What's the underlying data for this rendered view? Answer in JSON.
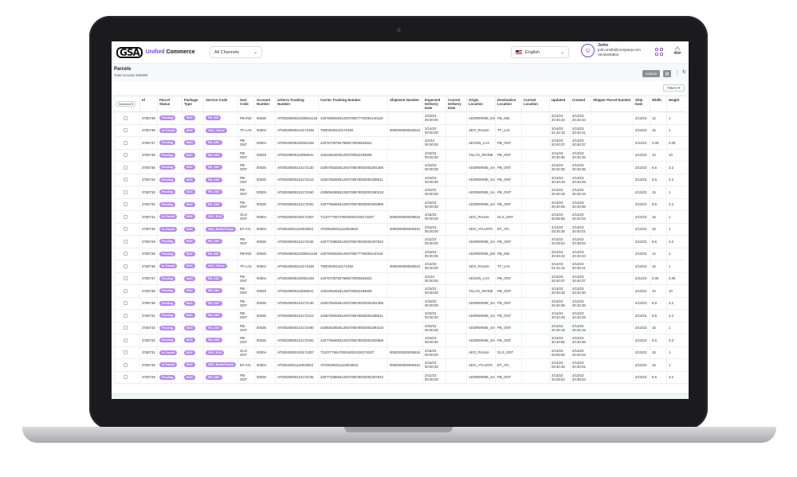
{
  "header": {
    "logo_mark": "GSA",
    "logo_accent": "Unified",
    "logo_text": "Commerce",
    "channel_select": "All Channels",
    "language_select": "English",
    "user_name": "John",
    "user_email": "john.smith@company.com",
    "user_role": "VendorEditor"
  },
  "page": {
    "title": "Parcels",
    "total_records": "Total records 340698",
    "actions_label": "Actions",
    "filters_label": "Filters",
    "selected_label": "Selected"
  },
  "columns": [
    "Id",
    "Parcel Status",
    "Package Type",
    "Service Code",
    "Sort Code",
    "Account Number",
    "airterra Tracking Number",
    "Carrier Tracking Number",
    "Shipment Number",
    "Expected Delivery Date",
    "Current Delivery Date",
    "Origin Location",
    "Destination Location",
    "Current Location",
    "Updated",
    "Created",
    "Shipper Parcel Number",
    "Ship Date",
    "Width",
    "Height"
  ],
  "rows": [
    {
      "id": "3750739",
      "status": "Pending",
      "type": "BOX",
      "service": "PB_IND",
      "sort": "PB-IND",
      "account": "00025",
      "airterra": "AT0002500021000621125",
      "carrier": "420760829261292700577702002140119",
      "shipment": "",
      "expected": "2/23/23 00:00:00",
      "current": "",
      "origin": "ADORERME_EWR",
      "dest": "PB_IND",
      "curloc": "",
      "updated": "2/13/23 20:40:43",
      "created": "2/13/23 20:40:43",
      "shipper": "",
      "shipdate": "2/13/23",
      "width": "12",
      "height": "1"
    },
    {
      "id": "3750738",
      "status": "In-Transit",
      "type": "BOX",
      "service": "GXC_Tforce",
      "sort": "TF-LAX",
      "account": "00004",
      "airterra": "AT00040000210174428",
      "carrier": "T0004000210174428",
      "shipment": "0000000000035524",
      "expected": "2/14/23 00:00:00",
      "current": "",
      "origin": "AEO_PALMA",
      "dest": "TF_LAX",
      "curloc": "",
      "updated": "2/14/23 01:42:15",
      "created": "2/13/23 20:40:41",
      "shipper": "",
      "shipdate": "2/13/23",
      "width": "15",
      "height": "1"
    },
    {
      "id": "3750737",
      "status": "Pending",
      "type": "BAG",
      "service": "PB_ONT",
      "sort": "PB-ONT",
      "account": "00004",
      "airterra": "AT00040006100002429",
      "carrier": "420757057927989270000554531",
      "shipment": "",
      "expected": "3/1/23 00:00:00",
      "current": "",
      "origin": "AEGON_LAX",
      "dest": "PB_ONT",
      "curloc": "",
      "updated": "2/13/23 20:40:37",
      "created": "2/13/23 20:40:37",
      "shipper": "",
      "shipdate": "2/21/23",
      "width": "0.05",
      "height": "0.05"
    },
    {
      "id": "3750736",
      "status": "Pending",
      "type": "BOX",
      "service": "PB_ONT",
      "sort": "PB-ONT",
      "account": "00029",
      "airterra": "AT00029000110094841",
      "carrier": "420225549261292700022293609",
      "shipment": "",
      "expected": "2/23/23 00:00:00",
      "current": "",
      "origin": "TILLYS_IRVINE",
      "dest": "PB_ONT",
      "curloc": "",
      "updated": "2/13/23 20:40:36",
      "created": "2/13/23 20:40:36",
      "shipper": "",
      "shipdate": "2/13/23",
      "width": "10",
      "height": "10"
    },
    {
      "id": "3750735",
      "status": "Pending",
      "type": "BOX",
      "service": "PB_ONT",
      "sort": "PB-ONT",
      "account": "00025",
      "airterra": "AT00025000110172130",
      "carrier": "420670529261292700578002002291308",
      "shipment": "",
      "expected": "2/23/23 00:00:00",
      "current": "",
      "origin": "ADORERME_SAN",
      "dest": "PB_ONT",
      "curloc": "",
      "updated": "2/13/23 20:40:35",
      "created": "2/13/23 20:40:35",
      "shipper": "",
      "shipdate": "2/13/23",
      "width": "8.5",
      "height": "3.2"
    },
    {
      "id": "3750734",
      "status": "Pending",
      "type": "BOX",
      "service": "PB_ONT",
      "sort": "PB-ONT",
      "account": "00025",
      "airterra": "AT00025000110172313",
      "carrier": "420670509261292700578002002298611",
      "shipment": "",
      "expected": "2/23/23 00:00:00",
      "current": "",
      "origin": "ADORERME_SAN",
      "dest": "PB_ONT",
      "curloc": "",
      "updated": "2/13/23 20:40:29",
      "created": "2/13/23 20:40:29",
      "shipper": "",
      "shipdate": "2/13/23",
      "width": "8.5",
      "height": "3.2"
    },
    {
      "id": "3750733",
      "status": "Pending",
      "type": "BOX",
      "service": "PB_ONT",
      "sort": "PB-ONT",
      "account": "00025",
      "airterra": "AT00025000110172490",
      "carrier": "420806289261292700578002002290219",
      "shipment": "",
      "expected": "2/23/23 00:00:00",
      "current": "",
      "origin": "ADORERME_SAN",
      "dest": "PB_ONT",
      "curloc": "",
      "updated": "2/13/23 20:40:19",
      "created": "2/13/23 20:40:19",
      "shipper": "",
      "shipdate": "2/13/23",
      "width": "15",
      "height": "1"
    },
    {
      "id": "3750732",
      "status": "Pending",
      "type": "BOX",
      "service": "PB_ONT",
      "sort": "PB-ONT",
      "account": "00025",
      "airterra": "AT00025000110172491",
      "carrier": "420775669261292700578002002293968",
      "shipment": "",
      "expected": "2/23/23 00:00:00",
      "current": "",
      "origin": "ADORERME_SAN",
      "dest": "PB_ONT",
      "curloc": "",
      "updated": "2/13/23 20:40:06",
      "created": "2/13/23 20:40:06",
      "shipper": "",
      "shipdate": "2/13/23",
      "width": "8.5",
      "height": "3.2"
    },
    {
      "id": "3750731",
      "status": "In-Transit",
      "type": "BOX",
      "service": "GXC_GLS",
      "sort": "GLS-ONT",
      "account": "00004",
      "airterra": "AT00040002100174307",
      "carrier": "T11077792AT00040002100174307",
      "shipment": "0000000000039524",
      "expected": "2/15/23 00:00:00",
      "current": "",
      "origin": "AEO_PALMA",
      "dest": "GLS_ONT",
      "curloc": "",
      "updated": "2/14/23 03:55:55",
      "created": "2/13/23 20:40:04",
      "shipper": "",
      "shipdate": "2/13/23",
      "width": "15",
      "height": "1"
    },
    {
      "id": "3750730",
      "status": "In-Transit",
      "type": "BOX",
      "service": "GXC_BetterTrucks",
      "sort": "BT-ATL",
      "account": "00004",
      "airterra": "AT00040001110003922",
      "carrier": "AT000400011110003922",
      "shipment": "0000000000039461",
      "expected": "2/15/23 00:00:00",
      "current": "",
      "origin": "AEO_ATLANTA",
      "dest": "BT_ATL",
      "curloc": "",
      "updated": "2/14/23 03:30:36",
      "created": "2/13/23 20:40:01",
      "shipper": "",
      "shipdate": "2/13/23",
      "width": "15",
      "height": "1"
    },
    {
      "id": "3750729",
      "status": "Pending",
      "type": "BOX",
      "service": "PB_ONT",
      "sort": "PB-ONT",
      "account": "00025",
      "airterra": "AT00025000110172435",
      "carrier": "420773389261292700578002002297522",
      "shipment": "",
      "expected": "2/21/23 00:00:00",
      "current": "",
      "origin": "ADORERME_SAN",
      "dest": "PB_ONT",
      "curloc": "",
      "updated": "2/13/23 20:39:54",
      "created": "2/13/23 20:39:54",
      "shipper": "",
      "shipdate": "2/13/23",
      "width": "8.5",
      "height": "3.2"
    },
    {
      "id": "3750739",
      "status": "Pending",
      "type": "BOX",
      "service": "PB_IND",
      "sort": "PB-IND",
      "account": "00025",
      "airterra": "AT0002500021000621125",
      "carrier": "420760829261292700577702002140119",
      "shipment": "",
      "expected": "2/23/23 00:00:00",
      "current": "",
      "origin": "ADORERME_EWR",
      "dest": "PB_IND",
      "curloc": "",
      "updated": "2/13/23 20:40:43",
      "created": "2/13/23 20:40:43",
      "shipper": "",
      "shipdate": "2/13/23",
      "width": "12",
      "height": "1"
    },
    {
      "id": "3750738",
      "status": "In-Transit",
      "type": "BOX",
      "service": "GXC_Tforce",
      "sort": "TF-LAX",
      "account": "00004",
      "airterra": "AT00040000210174428",
      "carrier": "T0004000210174428",
      "shipment": "0000000000035524",
      "expected": "2/14/23 00:00:00",
      "current": "",
      "origin": "AEO_PALMA",
      "dest": "TF_LAX",
      "curloc": "",
      "updated": "2/14/23 01:42:15",
      "created": "2/13/23 20:40:41",
      "shipper": "",
      "shipdate": "2/13/23",
      "width": "15",
      "height": "1"
    },
    {
      "id": "3750737",
      "status": "Pending",
      "type": "BAG",
      "service": "PB_ONT",
      "sort": "PB-ONT",
      "account": "00004",
      "airterra": "AT00040006100002429",
      "carrier": "420757057927989270000554531",
      "shipment": "",
      "expected": "3/1/23 00:00:00",
      "current": "",
      "origin": "AEGON_LAX",
      "dest": "PB_ONT",
      "curloc": "",
      "updated": "2/13/23 20:40:37",
      "created": "2/13/23 20:40:37",
      "shipper": "",
      "shipdate": "2/21/23",
      "width": "0.05",
      "height": "0.05"
    },
    {
      "id": "3750736",
      "status": "Pending",
      "type": "BOX",
      "service": "PB_ONT",
      "sort": "PB-ONT",
      "account": "00029",
      "airterra": "AT00029000110094841",
      "carrier": "420225549261292700022293609",
      "shipment": "",
      "expected": "2/23/23 00:00:00",
      "current": "",
      "origin": "TILLYS_IRVINE",
      "dest": "PB_ONT",
      "curloc": "",
      "updated": "2/13/23 20:40:36",
      "created": "2/13/23 20:40:36",
      "shipper": "",
      "shipdate": "2/13/23",
      "width": "10",
      "height": "10"
    },
    {
      "id": "3750735",
      "status": "Pending",
      "type": "BOX",
      "service": "PB_ONT",
      "sort": "PB-ONT",
      "account": "00025",
      "airterra": "AT00025000110172130",
      "carrier": "420670529261292700578002002291308",
      "shipment": "",
      "expected": "2/23/23 00:00:00",
      "current": "",
      "origin": "ADORERME_SAN",
      "dest": "PB_ONT",
      "curloc": "",
      "updated": "2/13/23 20:40:35",
      "created": "2/13/23 20:40:35",
      "shipper": "",
      "shipdate": "2/13/23",
      "width": "8.5",
      "height": "3.2"
    },
    {
      "id": "3750734",
      "status": "Pending",
      "type": "BOX",
      "service": "PB_ONT",
      "sort": "PB-ONT",
      "account": "00025",
      "airterra": "AT00025000110172313",
      "carrier": "420670509261292700578002002298611",
      "shipment": "",
      "expected": "2/23/23 00:00:00",
      "current": "",
      "origin": "ADORERME_SAN",
      "dest": "PB_ONT",
      "curloc": "",
      "updated": "2/13/23 20:40:29",
      "created": "2/13/23 20:40:29",
      "shipper": "",
      "shipdate": "2/13/23",
      "width": "8.5",
      "height": "3.2"
    },
    {
      "id": "3750733",
      "status": "Pending",
      "type": "BOX",
      "service": "PB_ONT",
      "sort": "PB-ONT",
      "account": "00025",
      "airterra": "AT00025000110172490",
      "carrier": "420806289261292700578002002290219",
      "shipment": "",
      "expected": "2/23/23 00:00:00",
      "current": "",
      "origin": "ADORERME_SAN",
      "dest": "PB_ONT",
      "curloc": "",
      "updated": "2/13/23 20:40:19",
      "created": "2/13/23 20:40:19",
      "shipper": "",
      "shipdate": "2/13/23",
      "width": "15",
      "height": "1"
    },
    {
      "id": "3750732",
      "status": "Pending",
      "type": "BOX",
      "service": "PB_ONT",
      "sort": "PB-ONT",
      "account": "00025",
      "airterra": "AT00025000110172491",
      "carrier": "420775669261292700578002002293968",
      "shipment": "",
      "expected": "2/23/23 00:00:00",
      "current": "",
      "origin": "ADORERME_SAN",
      "dest": "PB_ONT",
      "curloc": "",
      "updated": "2/13/23 20:40:06",
      "created": "2/13/23 20:40:06",
      "shipper": "",
      "shipdate": "2/13/23",
      "width": "8.5",
      "height": "3.2"
    },
    {
      "id": "3750731",
      "status": "In-Transit",
      "type": "BOX",
      "service": "GXC_GLS",
      "sort": "GLS-ONT",
      "account": "00004",
      "airterra": "AT00040002100174307",
      "carrier": "T11077792AT00040002100174307",
      "shipment": "0000000000039524",
      "expected": "2/15/23 00:00:00",
      "current": "",
      "origin": "AEO_PALMA",
      "dest": "GLS_ONT",
      "curloc": "",
      "updated": "2/14/23 03:55:55",
      "created": "2/13/23 20:40:04",
      "shipper": "",
      "shipdate": "2/13/23",
      "width": "15",
      "height": "1"
    },
    {
      "id": "3750730",
      "status": "In-Transit",
      "type": "BOX",
      "service": "GXC_BetterTrucks",
      "sort": "BT-ATL",
      "account": "00004",
      "airterra": "AT00040001110003922",
      "carrier": "AT000400011110003922",
      "shipment": "0000000000039461",
      "expected": "2/15/23 00:00:00",
      "current": "",
      "origin": "AEO_ATLANTA",
      "dest": "BT_ATL",
      "curloc": "",
      "updated": "2/14/23 03:30:36",
      "created": "2/13/23 20:40:01",
      "shipper": "",
      "shipdate": "2/13/23",
      "width": "15",
      "height": "1"
    },
    {
      "id": "3750729",
      "status": "Pending",
      "type": "BOX",
      "service": "PB_ONT",
      "sort": "PB-ONT",
      "account": "00025",
      "airterra": "AT00025000110172435",
      "carrier": "420773389261292700578002002297522",
      "shipment": "",
      "expected": "2/21/23 00:00:00",
      "current": "",
      "origin": "ADORERME_SAN",
      "dest": "PB_ONT",
      "curloc": "",
      "updated": "2/13/23 20:39:54",
      "created": "2/13/23 20:39:54",
      "shipper": "",
      "shipdate": "2/13/23",
      "width": "8.5",
      "height": "3.2"
    }
  ],
  "colors": {
    "accent": "#7b3fe4",
    "pill": "#b689f2",
    "button": "#8e8e93"
  }
}
